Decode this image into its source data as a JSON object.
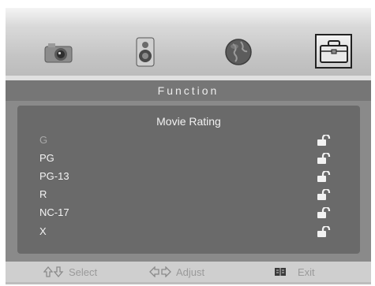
{
  "tabs": [
    {
      "name": "picture-tab-icon",
      "selected": false
    },
    {
      "name": "speaker-tab-icon",
      "selected": false
    },
    {
      "name": "globe-tab-icon",
      "selected": false
    },
    {
      "name": "toolbox-tab-icon",
      "selected": true
    }
  ],
  "section": {
    "title": "Function"
  },
  "panel": {
    "title": "Movie Rating",
    "rows": [
      {
        "label": "G",
        "state": "unlocked",
        "enabled": false
      },
      {
        "label": "PG",
        "state": "unlocked",
        "enabled": true
      },
      {
        "label": "PG-13",
        "state": "unlocked",
        "enabled": true
      },
      {
        "label": "R",
        "state": "unlocked",
        "enabled": true
      },
      {
        "label": "NC-17",
        "state": "unlocked",
        "enabled": true
      },
      {
        "label": "X",
        "state": "unlocked",
        "enabled": true
      }
    ]
  },
  "help": {
    "select": {
      "icon": "up-down-arrows-icon",
      "label": "Select"
    },
    "adjust": {
      "icon": "left-right-arrows-icon",
      "label": "Adjust"
    },
    "exit": {
      "icon": "menu-book-icon",
      "label": "Exit"
    }
  },
  "colors": {
    "title_bar": "#767676",
    "panel_bg": "#6a6a6a",
    "band_bg": "#8a8a8a",
    "help_bar": "#cfcfcf"
  }
}
